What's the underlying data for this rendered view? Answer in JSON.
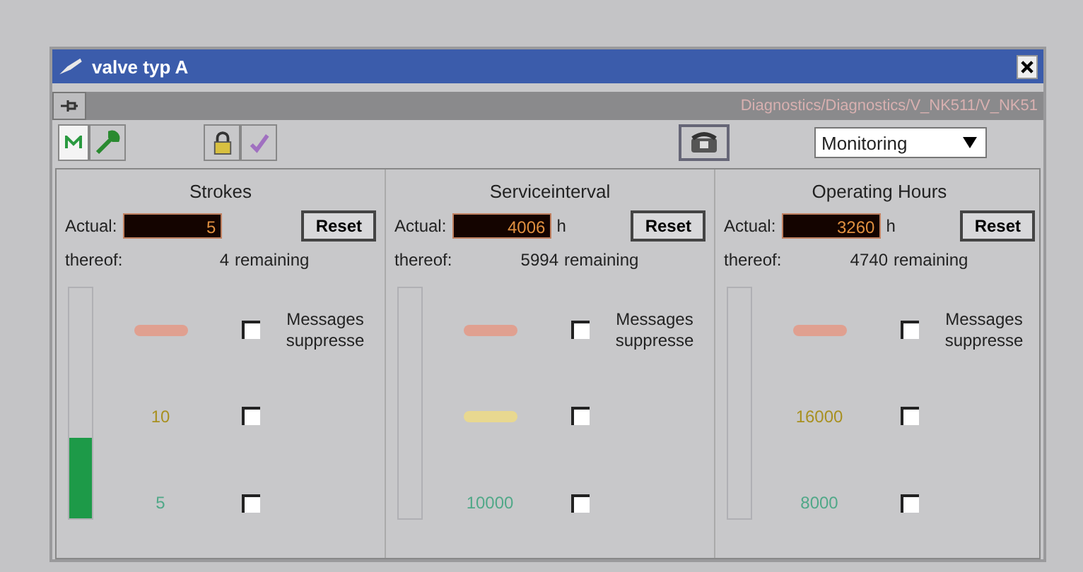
{
  "window": {
    "title": "valve typ A"
  },
  "path_bar": {
    "path": "Diagnostics/Diagnostics/V_NK511/V_NK51"
  },
  "toolbar": {
    "mode": "Monitoring"
  },
  "panels": [
    {
      "title": "Strokes",
      "actual_label": "Actual:",
      "actual": "5",
      "reset": "Reset",
      "thereof_label": "thereof:",
      "remaining": "4",
      "remaining_label": "remaining",
      "level": 0.35,
      "thresholds": [
        {
          "color": "#e0a090",
          "checked": false,
          "note": "Messages suppresse"
        },
        {
          "color": "#a89020",
          "label": "10",
          "checked": false
        },
        {
          "color": "#50a888",
          "label": "5",
          "checked": false
        }
      ]
    },
    {
      "title": "Serviceinterval",
      "actual_label": "Actual:",
      "actual": "4006",
      "unit": "h",
      "reset": "Reset",
      "thereof_label": "thereof:",
      "remaining": "5994",
      "remaining_label": "remaining",
      "thresholds": [
        {
          "color": "#e0a090",
          "checked": false,
          "note": "Messages suppresse"
        },
        {
          "color": "#e8d890",
          "checked": false
        },
        {
          "color": "#50a888",
          "label": "10000",
          "checked": false
        }
      ]
    },
    {
      "title": "Operating Hours",
      "actual_label": "Actual:",
      "actual": "3260",
      "unit": "h",
      "reset": "Reset",
      "thereof_label": "thereof:",
      "remaining": "4740",
      "remaining_label": "remaining",
      "thresholds": [
        {
          "color": "#e0a090",
          "checked": false,
          "note": "Messages suppresse"
        },
        {
          "color": "#a89020",
          "label": "16000",
          "checked": false
        },
        {
          "color": "#50a888",
          "label": "8000",
          "checked": false
        }
      ]
    }
  ]
}
